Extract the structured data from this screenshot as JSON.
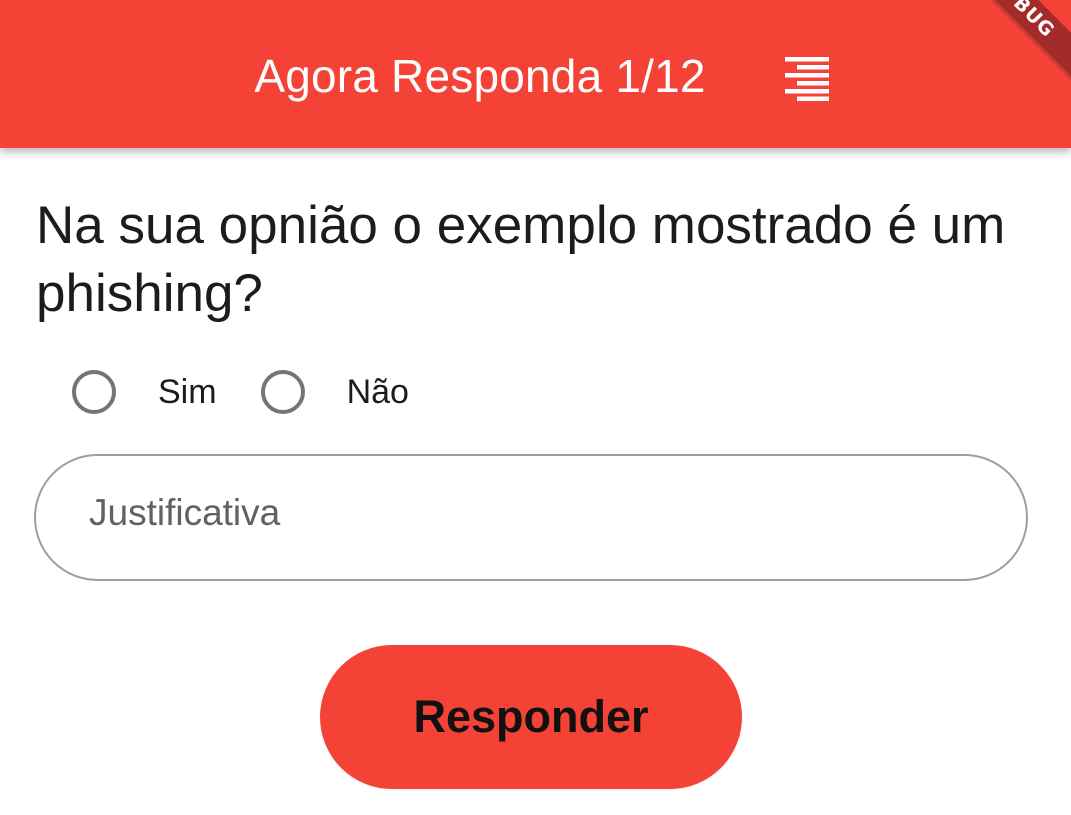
{
  "app_bar": {
    "title": "Agora Responda 1/12",
    "menu_icon": "menu-align-right-icon",
    "background_color": "#f44336",
    "title_color": "#ffffff"
  },
  "debug_banner": {
    "label": "BUG",
    "color": "#a52a2a"
  },
  "question": {
    "text": "Na sua opnião o exemplo mostrado é um phishing?"
  },
  "answer_options": [
    {
      "label": "Sim",
      "selected": false
    },
    {
      "label": "Não",
      "selected": false
    }
  ],
  "justification": {
    "value": "",
    "placeholder": "Justificativa"
  },
  "submit": {
    "label": "Responder",
    "background_color": "#f44336"
  }
}
